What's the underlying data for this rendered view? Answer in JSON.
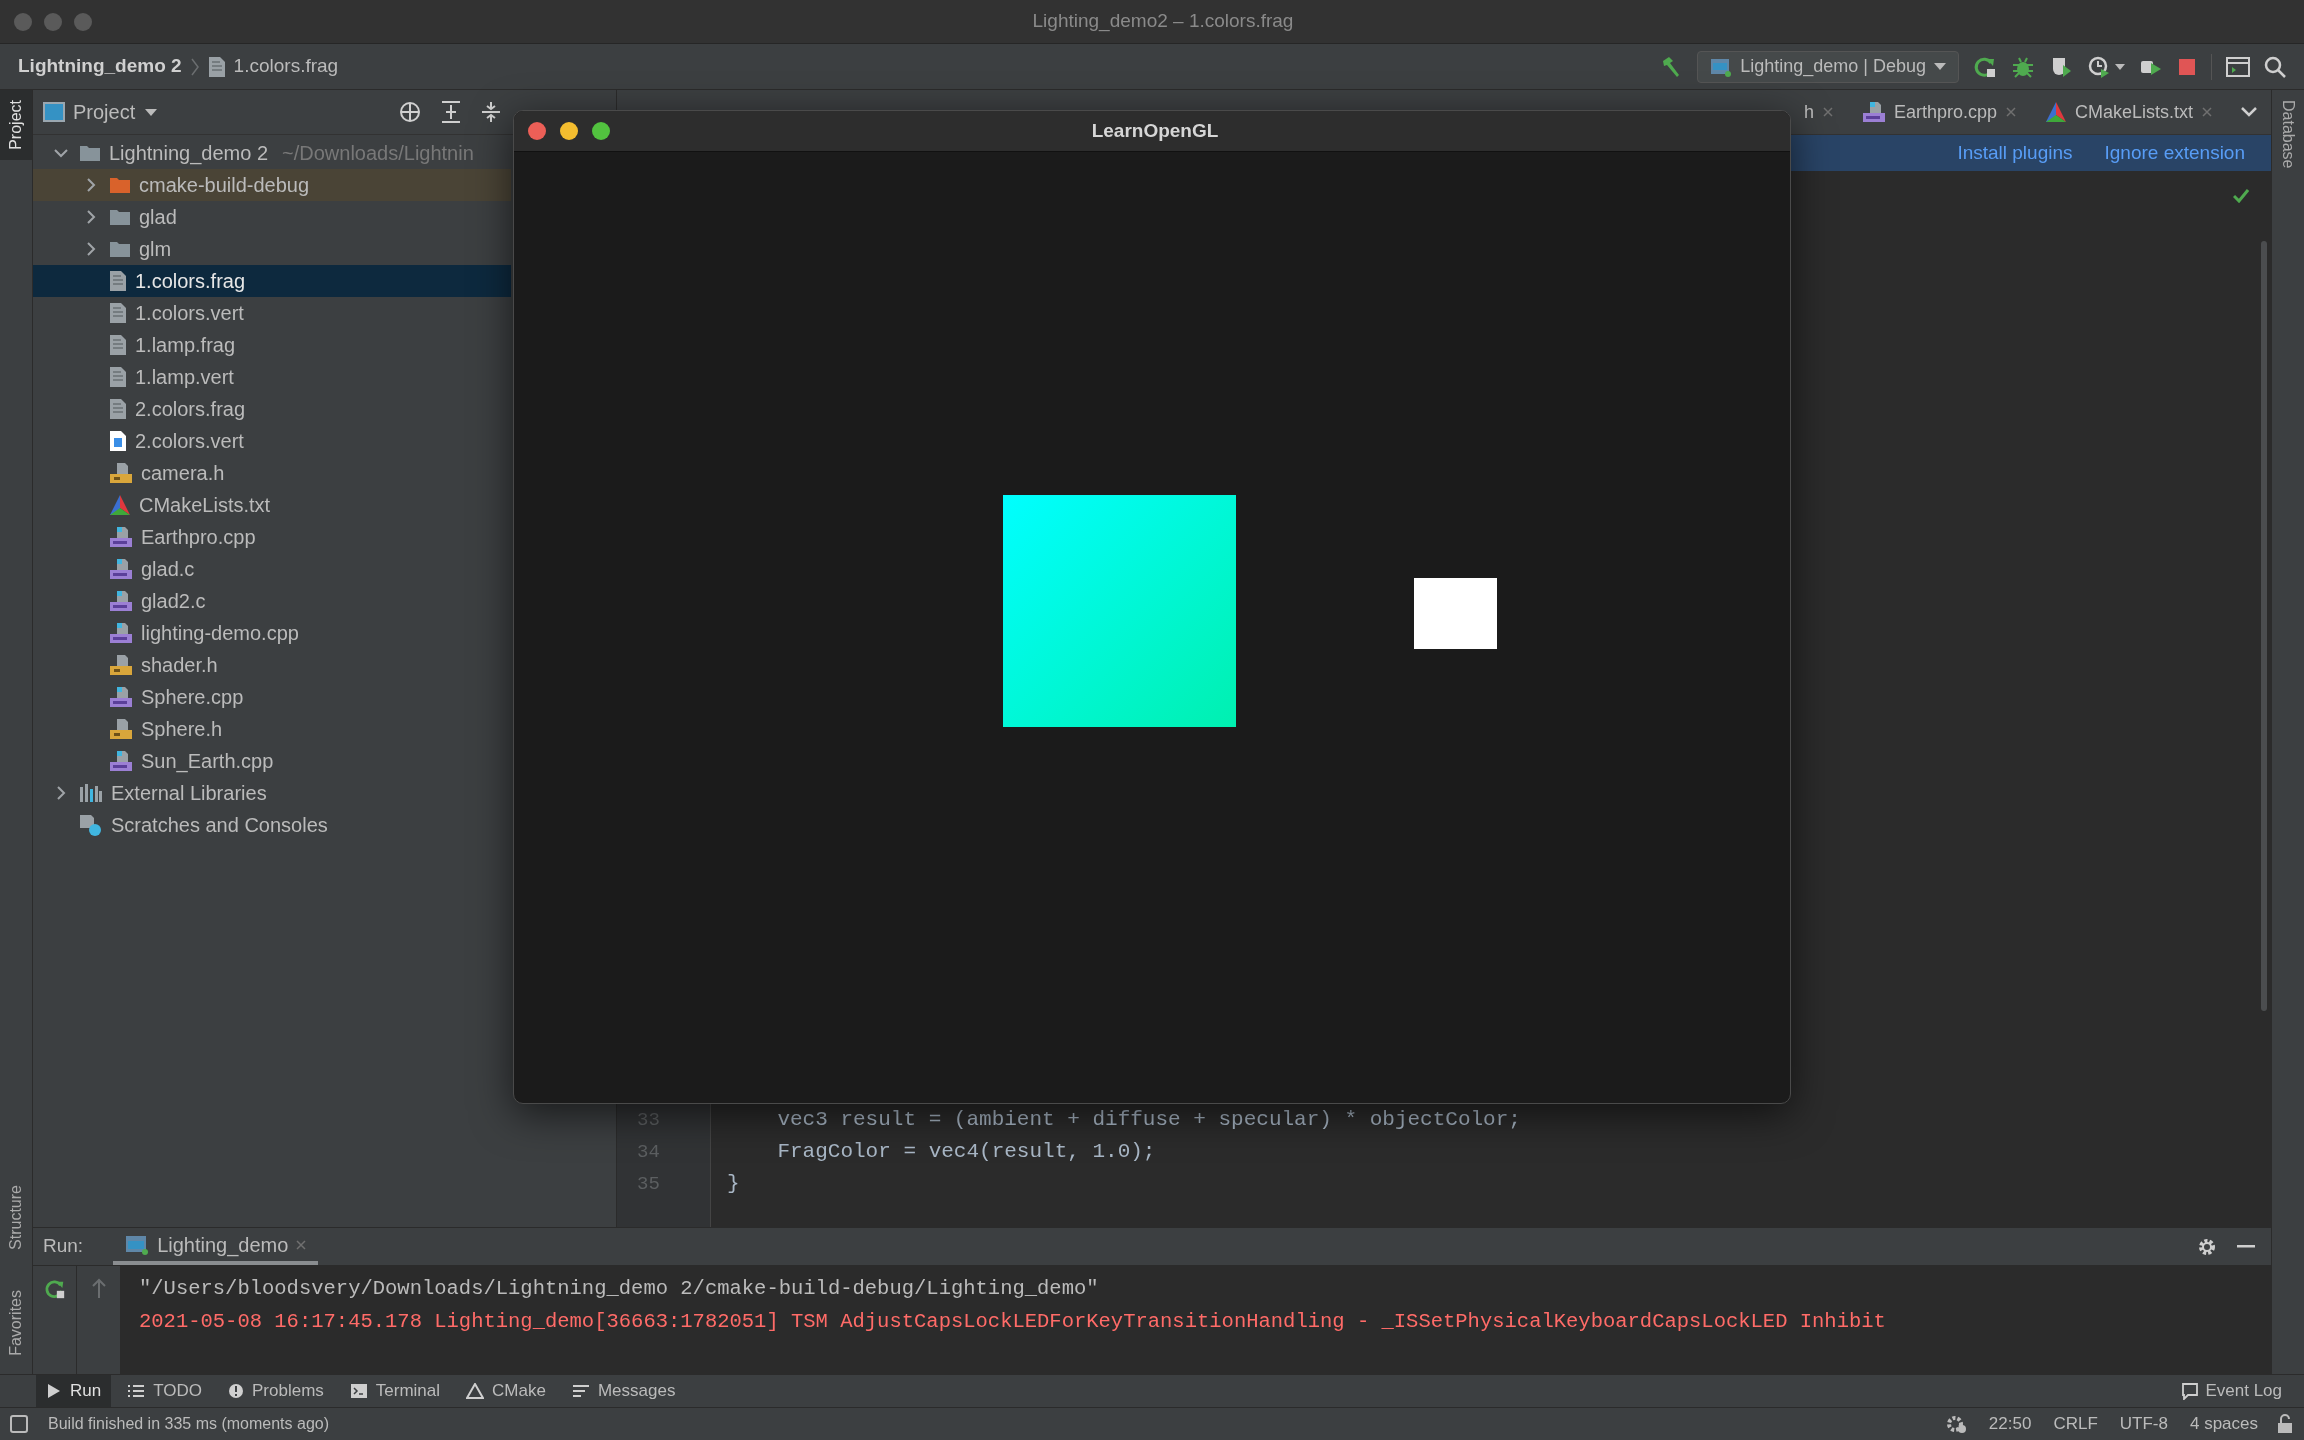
{
  "window": {
    "title": "Lighting_demo2 – 1.colors.frag"
  },
  "navbar": {
    "breadcrumb": [
      "Lightning_demo 2",
      "1.colors.frag"
    ],
    "run_config": "Lighting_demo | Debug"
  },
  "left_stripe": [
    {
      "label": "Project",
      "selected": true,
      "kind": "top"
    },
    {
      "label": "Structure",
      "selected": false,
      "kind": "bottom"
    },
    {
      "label": "Favorites",
      "selected": false,
      "kind": "bottom"
    }
  ],
  "right_stripe": [
    {
      "label": "Database",
      "selected": false
    }
  ],
  "project": {
    "title": "Project",
    "tree": [
      {
        "label": "Lightning_demo 2",
        "path": "~/Downloads/Lightnin",
        "kind": "folder",
        "expanded": true,
        "selected": false,
        "children": [
          {
            "label": "cmake-build-debug",
            "kind": "excluded-folder",
            "expanded": false,
            "selected": false
          },
          {
            "label": "glad",
            "kind": "folder",
            "expanded": false,
            "selected": false
          },
          {
            "label": "glm",
            "kind": "folder",
            "expanded": false,
            "selected": false
          },
          {
            "label": "1.colors.frag",
            "kind": "shader",
            "selected": true
          },
          {
            "label": "1.colors.vert",
            "kind": "shader",
            "selected": false
          },
          {
            "label": "1.lamp.frag",
            "kind": "shader",
            "selected": false
          },
          {
            "label": "1.lamp.vert",
            "kind": "shader",
            "selected": false
          },
          {
            "label": "2.colors.frag",
            "kind": "shader",
            "selected": false
          },
          {
            "label": "2.colors.vert",
            "kind": "text",
            "selected": false
          },
          {
            "label": "camera.h",
            "kind": "header",
            "selected": false
          },
          {
            "label": "CMakeLists.txt",
            "kind": "cmake",
            "selected": false
          },
          {
            "label": "Earthpro.cpp",
            "kind": "cpp",
            "selected": false
          },
          {
            "label": "glad.c",
            "kind": "cpp",
            "selected": false
          },
          {
            "label": "glad2.c",
            "kind": "cpp",
            "selected": false
          },
          {
            "label": "lighting-demo.cpp",
            "kind": "cpp",
            "selected": false
          },
          {
            "label": "shader.h",
            "kind": "header",
            "selected": false
          },
          {
            "label": "Sphere.cpp",
            "kind": "cpp",
            "selected": false
          },
          {
            "label": "Sphere.h",
            "kind": "header",
            "selected": false
          },
          {
            "label": "Sun_Earth.cpp",
            "kind": "cpp",
            "selected": false
          }
        ]
      },
      {
        "label": "External Libraries",
        "kind": "libraries",
        "expanded": false,
        "selected": false
      },
      {
        "label": "Scratches and Consoles",
        "kind": "scratches",
        "selected": false
      }
    ]
  },
  "editor": {
    "tabs": [
      {
        "label": "h",
        "selected": false
      },
      {
        "label": "Earthpro.cpp",
        "kind": "cpp",
        "selected": false
      },
      {
        "label": "CMakeLists.txt",
        "kind": "cmake",
        "selected": false
      }
    ],
    "banner": {
      "actions": [
        "Install plugins",
        "Ignore extension"
      ]
    },
    "lines": [
      {
        "number": "33",
        "code": "    vec3 result = (ambient + diffuse + specular) * objectColor;"
      },
      {
        "number": "34",
        "code": "    FragColor = vec4(result, 1.0);"
      },
      {
        "number": "35",
        "code": "}"
      }
    ]
  },
  "opengl_window": {
    "title": "LearnOpenGL"
  },
  "run": {
    "label": "Run:",
    "tab": "Lighting_demo",
    "output": [
      {
        "kind": "command",
        "text": "\"/Users/bloodsvery/Downloads/Lightning_demo 2/cmake-build-debug/Lighting_demo\""
      },
      {
        "kind": "error",
        "text": "2021-05-08 16:17:45.178 Lighting_demo[36663:1782051] TSM AdjustCapsLockLEDForKeyTransitionHandling - _ISSetPhysicalKeyboardCapsLockLED Inhibit"
      }
    ]
  },
  "tool_tabs": [
    {
      "label": "Run",
      "kind": "run",
      "selected": true
    },
    {
      "label": "TODO",
      "kind": "list",
      "selected": false
    },
    {
      "label": "Problems",
      "kind": "problems",
      "selected": false
    },
    {
      "label": "Terminal",
      "kind": "terminal",
      "selected": false
    },
    {
      "label": "CMake",
      "kind": "cmake",
      "selected": false
    },
    {
      "label": "Messages",
      "kind": "messages",
      "selected": false
    }
  ],
  "event_log": "Event Log",
  "status_bar": {
    "message": "Build finished in 335 ms (moments ago)",
    "items": [
      "22:50",
      "CRLF",
      "UTF-8",
      "4 spaces"
    ]
  }
}
